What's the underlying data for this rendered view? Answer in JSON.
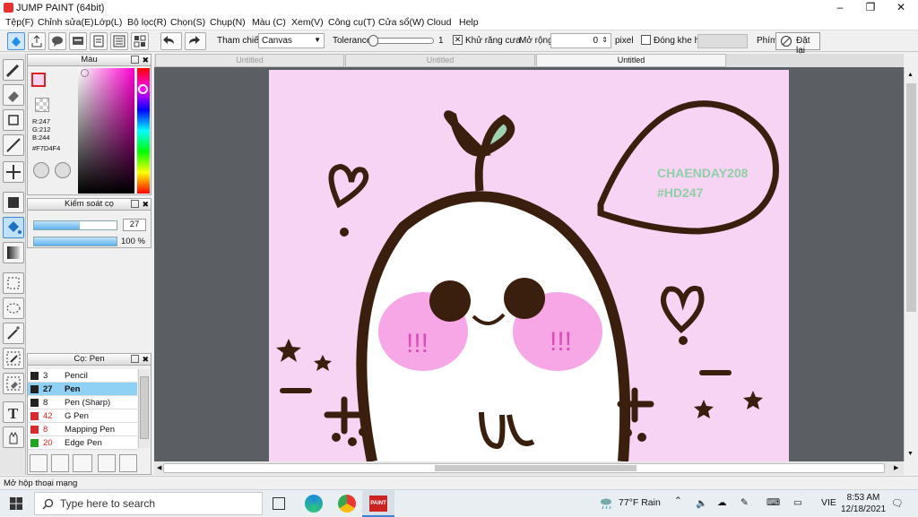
{
  "window": {
    "title": "JUMP PAINT (64bit)"
  },
  "menu": [
    "Tệp(F)",
    "Chỉnh sửa(E)",
    "Lớp(L)",
    "Bộ lọc(R)",
    "Chọn(S)",
    "Chụp(N)",
    "Màu (C)",
    "Xem(V)",
    "Công cụ(T)",
    "Cửa sổ(W)",
    "Cloud",
    "Help"
  ],
  "toolbar": {
    "reference_label": "Tham chiếu",
    "reference_value": "Canvas",
    "tolerance_label": "Tolerance",
    "tolerance_value": "1",
    "antialias_label": "Khử răng cưa",
    "expand_label": "Mở rộng",
    "expand_value": "0",
    "expand_unit": "pixel",
    "close_gap_label": "Đóng khe hở",
    "key_label": "Phím",
    "reset_label": "Đặt lại"
  },
  "color_panel": {
    "title": "Màu",
    "r": "R:247",
    "g": "G:212",
    "b": "B:244",
    "hex": "#F7D4F4",
    "current_color": "#f7d4f4"
  },
  "brush_control": {
    "title": "Kiểm soát cọ",
    "size": "27",
    "opacity": "100 %",
    "size_fraction": 0.55,
    "opacity_fraction": 1.0
  },
  "brush_list": {
    "title": "Cọ: Pen",
    "items": [
      {
        "size": "3",
        "name": "Pencil",
        "color": "#222222"
      },
      {
        "size": "27",
        "name": "Pen",
        "color": "#222222"
      },
      {
        "size": "8",
        "name": "Pen (Sharp)",
        "color": "#222222"
      },
      {
        "size": "42",
        "name": "G Pen",
        "color": "#d92b2b"
      },
      {
        "size": "8",
        "name": "Mapping Pen",
        "color": "#d92b2b"
      },
      {
        "size": "20",
        "name": "Edge Pen",
        "color": "#23a323"
      }
    ]
  },
  "tabs": [
    "Untitled",
    "Untitled",
    "Untitled"
  ],
  "artwork": {
    "watermark_line1": "CHAENDAY208",
    "watermark_line2": "#HD247",
    "cheek_text": "!!!"
  },
  "status": {
    "text": "Mở hộp thoại mạng"
  },
  "taskbar": {
    "search_placeholder": "Type here to search",
    "weather": "77°F  Rain",
    "lang": "VIE",
    "time": "8:53 AM",
    "date": "12/18/2021"
  },
  "colors": {
    "canvas_bg": "#f7d4f4",
    "ink": "#3b1f0e",
    "accent_blue": "#1e90e6",
    "leaf": "#9fd2b0",
    "blush": "#f7a6e6"
  }
}
